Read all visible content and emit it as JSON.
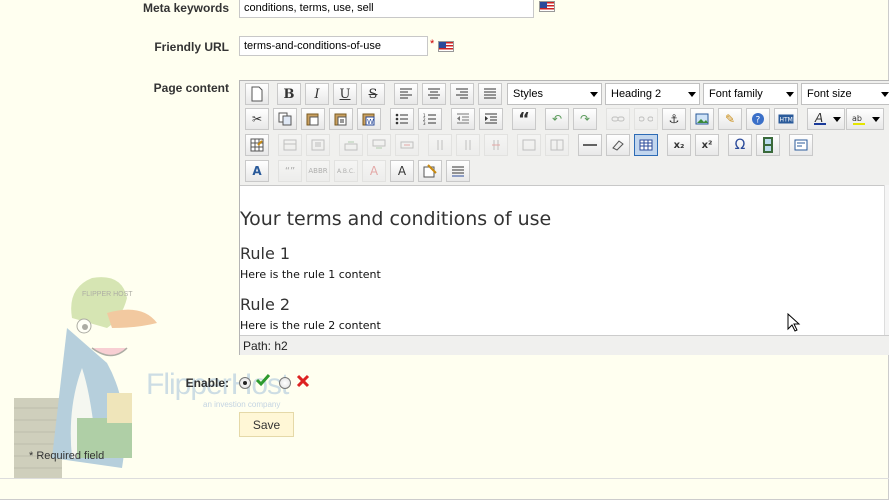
{
  "form": {
    "meta_keywords": {
      "label": "Meta keywords",
      "value": "conditions, terms, use, sell"
    },
    "friendly_url": {
      "label": "Friendly URL",
      "value": "terms-and-conditions-of-use",
      "required_mark": "*"
    },
    "page_content": {
      "label": "Page content"
    },
    "enable": {
      "label": "Enable:",
      "selected": "yes"
    },
    "save_label": "Save",
    "required_note": "* Required field"
  },
  "editor": {
    "dropdowns": {
      "styles": "Styles",
      "format": "Heading 2",
      "font_family": "Font family",
      "font_size": "Font size"
    },
    "content": {
      "title": "Your terms and conditions of use",
      "rules": [
        {
          "heading": "Rule 1",
          "text": "Here is the rule 1 content"
        },
        {
          "heading": "Rule 2",
          "text": "Here is the rule 2 content"
        }
      ]
    },
    "path": "Path: h2"
  },
  "logo": {
    "name": "FlipperHost",
    "tagline": "an investion company",
    "cap_text": "FLIPPER HOST"
  },
  "colors": {
    "page_bg": "#fffff0",
    "accent_green": "#2e9a2e",
    "accent_red": "#d22",
    "save_bg": "#fff7d6"
  }
}
